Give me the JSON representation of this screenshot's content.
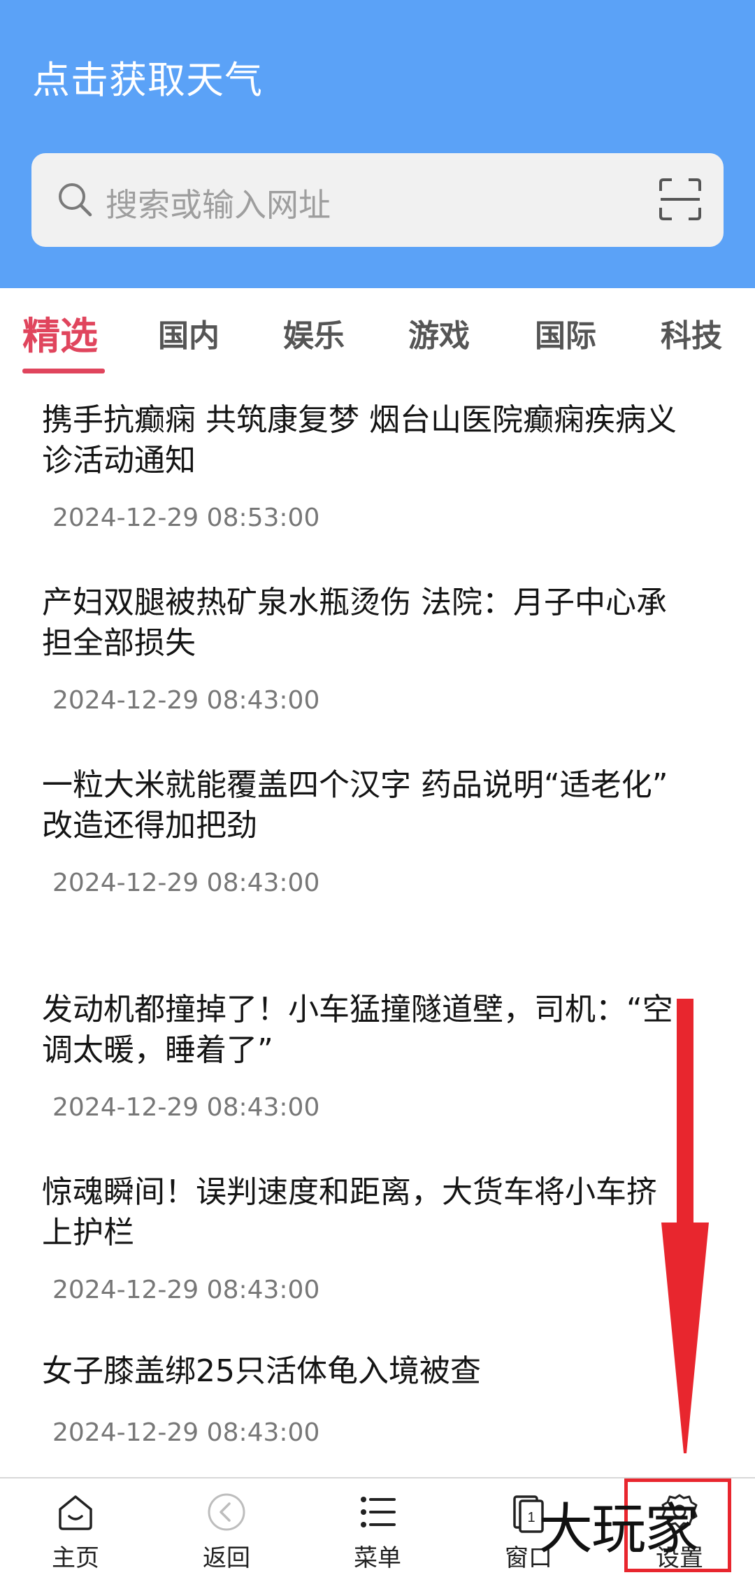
{
  "header": {
    "weather_label": "点击获取天气",
    "search_placeholder": "搜索或输入网址",
    "background": "#5ba2f7"
  },
  "tabs": [
    {
      "label": "精选",
      "active": true
    },
    {
      "label": "国内",
      "active": false
    },
    {
      "label": "娱乐",
      "active": false
    },
    {
      "label": "游戏",
      "active": false
    },
    {
      "label": "国际",
      "active": false
    },
    {
      "label": "科技",
      "active": false
    }
  ],
  "news": [
    {
      "line1": "携手抗癫痫 共筑康复梦 烟台山医院癫痫疾病义",
      "line2": "诊活动通知",
      "time": "2024-12-29 08:53:00"
    },
    {
      "line1": "产妇双腿被热矿泉水瓶烫伤 法院：月子中心承",
      "line2": "担全部损失",
      "time": "2024-12-29 08:43:00"
    },
    {
      "line1": "一粒大米就能覆盖四个汉字 药品说明“适老化”",
      "line2": "改造还得加把劲",
      "time": "2024-12-29 08:43:00"
    },
    {
      "line1": "发动机都撞掉了！小车猛撞隧道壁，司机：“空",
      "line2": "调太暖，睡着了”",
      "time": "2024-12-29 08:43:00"
    },
    {
      "line1": "惊魂瞬间！误判速度和距离，大货车将小车挤",
      "line2": "上护栏",
      "time": "2024-12-29 08:43:00"
    },
    {
      "line1": "女子膝盖绑25只活体龟入境被查",
      "line2": "",
      "time": "2024-12-29 08:43:00"
    }
  ],
  "bottom_nav": [
    {
      "label": "主页",
      "icon": "home-icon"
    },
    {
      "label": "返回",
      "icon": "back-icon"
    },
    {
      "label": "菜单",
      "icon": "menu-icon"
    },
    {
      "label": "窗口",
      "icon": "window-icon",
      "badge": "1"
    },
    {
      "label": "设置",
      "icon": "gear-icon"
    }
  ],
  "overlay": {
    "watermark": "大玩家",
    "arrow_color": "#e8262e"
  }
}
